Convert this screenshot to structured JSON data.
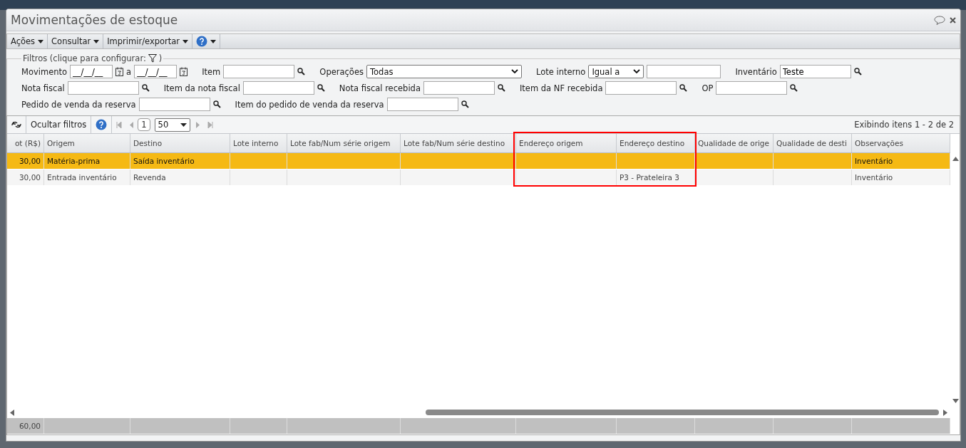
{
  "window": {
    "title": "Movimentações de estoque"
  },
  "toolbar": [
    {
      "label": "Ações",
      "kind": "menu"
    },
    {
      "label": "Consultar",
      "kind": "menu"
    },
    {
      "label": "Imprimir/exportar",
      "kind": "menu"
    },
    {
      "kind": "help"
    }
  ],
  "filters": {
    "legend": "Filtros (clique para configurar:",
    "legend_end": ")",
    "rows": [
      [
        {
          "label": "Movimento",
          "kind": "daterange",
          "value": "__/__/__",
          "value2": "__/__/__",
          "sep": "a"
        },
        {
          "label": "Item",
          "kind": "lookup"
        },
        {
          "label": "Operações",
          "kind": "select",
          "value": "Todas"
        },
        {
          "label": "Lote interno",
          "kind": "compare",
          "value": "Igual a"
        },
        {
          "label": "Inventário",
          "kind": "lookup",
          "value": "Teste"
        }
      ],
      [
        {
          "label": "Nota fiscal",
          "kind": "lookup"
        },
        {
          "label": "Item da nota fiscal",
          "kind": "lookup"
        },
        {
          "label": "Nota fiscal recebida",
          "kind": "lookup"
        },
        {
          "label": "Item da NF recebida",
          "kind": "lookup"
        },
        {
          "label": "OP",
          "kind": "lookup"
        }
      ],
      [
        {
          "label": "Pedido de venda da reserva",
          "kind": "lookup"
        },
        {
          "label": "Item do pedido de venda da reserva",
          "kind": "lookup"
        }
      ]
    ]
  },
  "grid_toolbar": {
    "hide_filters": "Ocultar filtros",
    "page": "1",
    "page_size": "50",
    "status": "Exibindo itens 1 - 2 de 2"
  },
  "table": {
    "columns": [
      {
        "label": "ot (R$)",
        "highlighted": false
      },
      {
        "label": "Origem",
        "highlighted": false
      },
      {
        "label": "Destino",
        "highlighted": false
      },
      {
        "label": "Lote interno",
        "highlighted": false
      },
      {
        "label": "Lote fab/Num série origem",
        "highlighted": false
      },
      {
        "label": "Lote fab/Num série destino",
        "highlighted": false
      },
      {
        "label": "Endereço origem",
        "highlighted": true
      },
      {
        "label": "Endereço destino",
        "highlighted": true
      },
      {
        "label": "Qualidade de orige",
        "highlighted": false
      },
      {
        "label": "Qualidade de desti",
        "highlighted": false
      },
      {
        "label": "Observações",
        "highlighted": false
      }
    ],
    "rows": [
      {
        "selected": true,
        "cells": [
          "30,00",
          "Matéria-prima",
          "Saída inventário",
          null,
          null,
          null,
          null,
          null,
          null,
          null,
          "Inventário"
        ]
      },
      {
        "selected": false,
        "cells": [
          "30,00",
          "Entrada inventário",
          "Revenda",
          null,
          null,
          null,
          null,
          "P3 - Prateleira 3",
          null,
          null,
          "Inventário"
        ]
      }
    ],
    "total": "60,00"
  }
}
